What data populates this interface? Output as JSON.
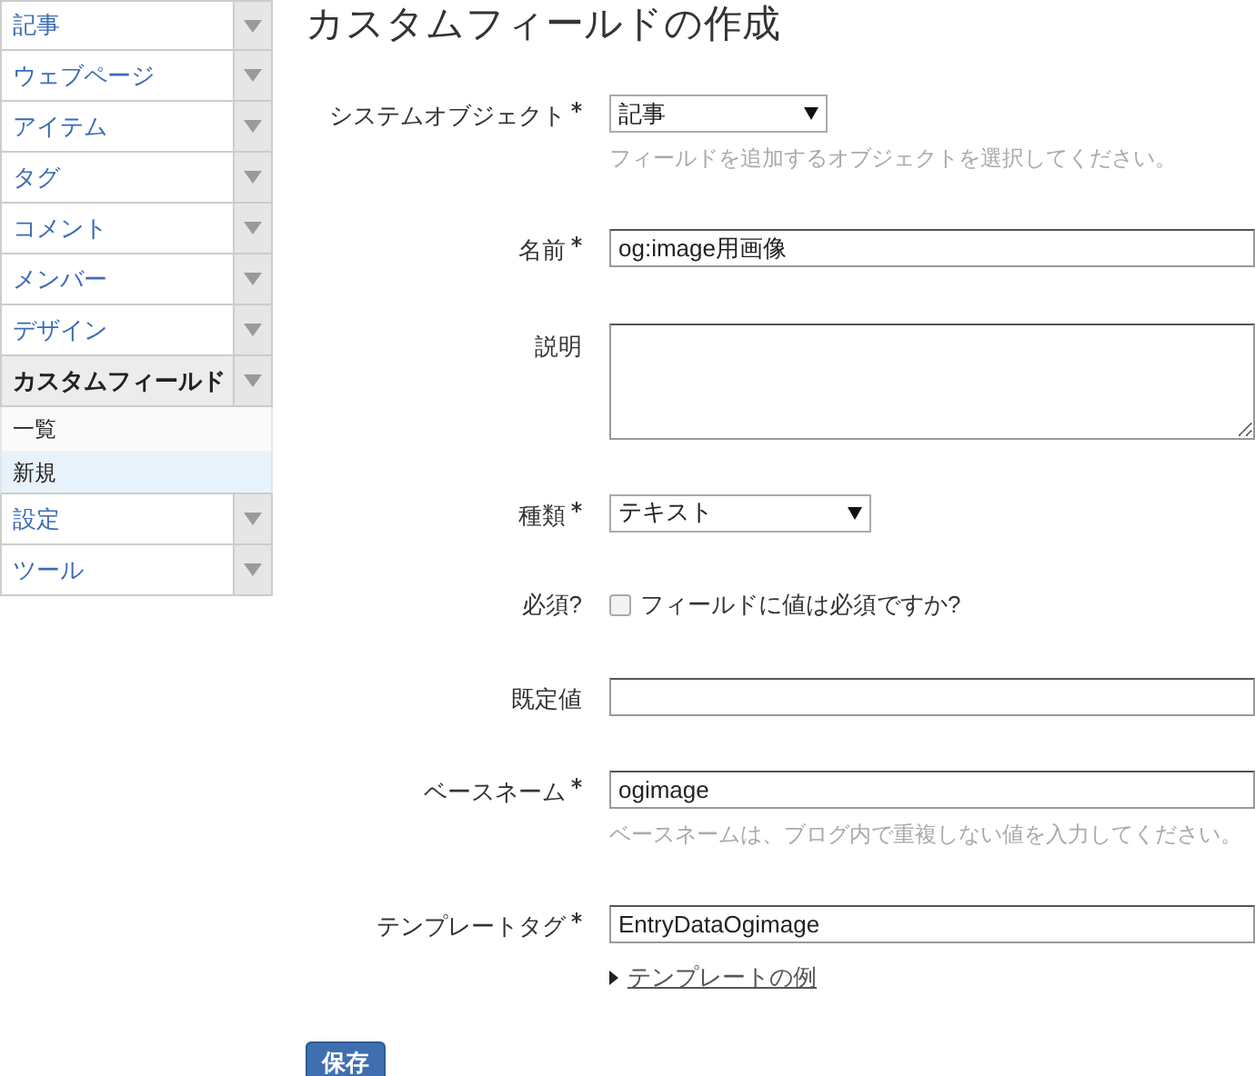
{
  "sidebar": {
    "items": [
      {
        "label": "記事",
        "expanded": false
      },
      {
        "label": "ウェブページ",
        "expanded": false
      },
      {
        "label": "アイテム",
        "expanded": false
      },
      {
        "label": "タグ",
        "expanded": false
      },
      {
        "label": "コメント",
        "expanded": false
      },
      {
        "label": "メンバー",
        "expanded": false
      },
      {
        "label": "デザイン",
        "expanded": false
      },
      {
        "label": "カスタムフィールド",
        "expanded": true,
        "children": [
          {
            "label": "一覧",
            "selected": false
          },
          {
            "label": "新規",
            "selected": true
          }
        ]
      },
      {
        "label": "設定",
        "expanded": false
      },
      {
        "label": "ツール",
        "expanded": false
      }
    ]
  },
  "page_title": "カスタムフィールドの作成",
  "form": {
    "fields": [
      {
        "kind": "select",
        "label": "システムオブジェクト",
        "required": true,
        "value": "記事",
        "hint": "フィールドを追加するオブジェクトを選択してください。"
      },
      {
        "kind": "text",
        "label": "名前",
        "required": true,
        "value": "og:image用画像"
      },
      {
        "kind": "textarea",
        "label": "説明",
        "required": false
      },
      {
        "kind": "select",
        "label": "種類",
        "required": true,
        "value": "テキスト"
      },
      {
        "kind": "checkbox",
        "label": "必須?",
        "required": false,
        "option": "フィールドに値は必須ですか?",
        "checked": false
      },
      {
        "kind": "text",
        "label": "既定値",
        "required": false
      },
      {
        "kind": "text",
        "label": "ベースネーム",
        "required": true,
        "value": "ogimage",
        "hint": "ベースネームは、ブログ内で重複しない値を入力してください。"
      },
      {
        "kind": "text",
        "label": "テンプレートタグ",
        "required": true,
        "value": "EntryDataOgimage",
        "link": "テンプレートの例"
      }
    ],
    "save_button": "保存"
  }
}
